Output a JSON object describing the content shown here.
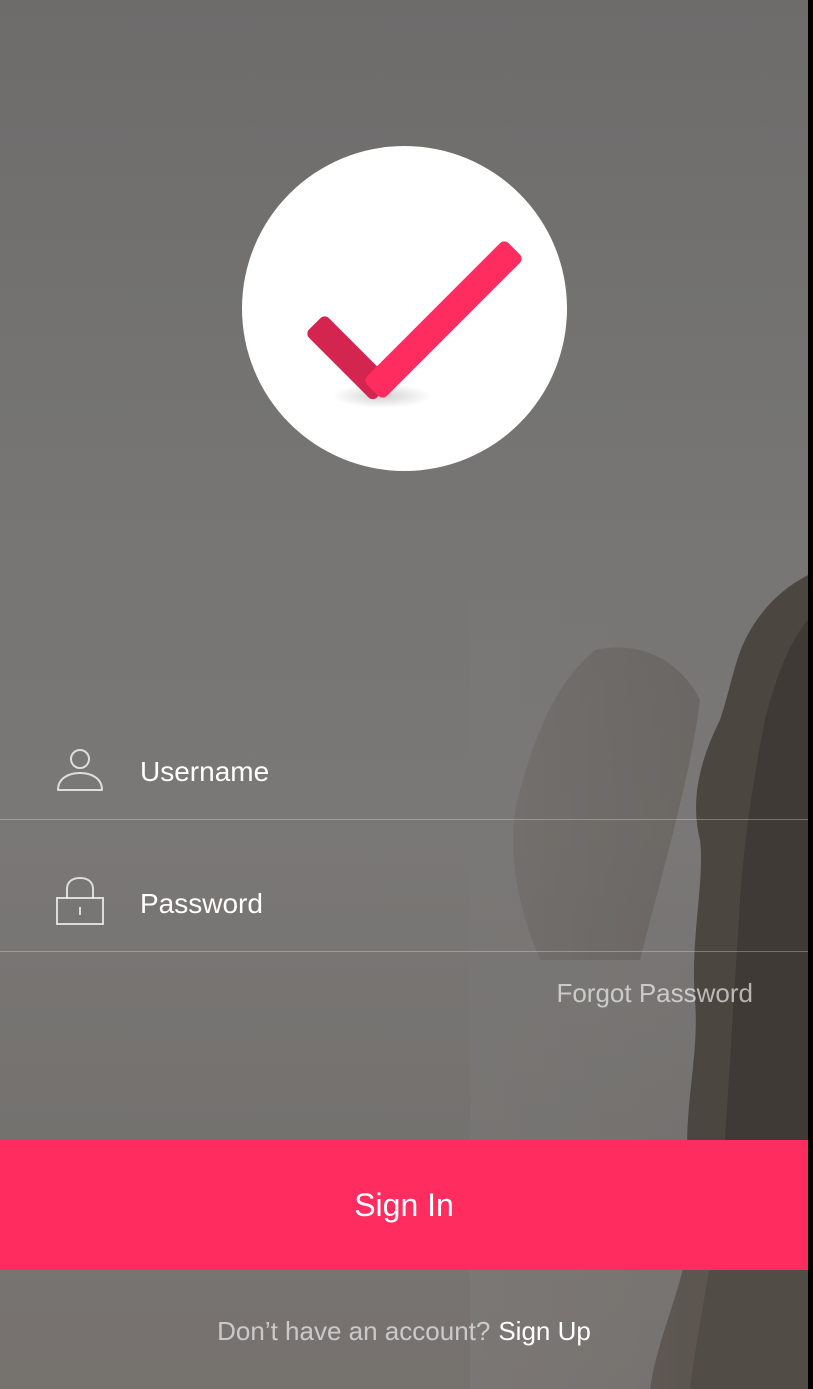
{
  "logo": {
    "icon": "checkmark-icon",
    "circle_color": "#ffffff",
    "check_color": "#ff2d5f"
  },
  "form": {
    "username": {
      "icon": "user-icon",
      "placeholder": "Username",
      "value": ""
    },
    "password": {
      "icon": "lock-icon",
      "placeholder": "Password",
      "value": ""
    },
    "forgot_password_label": "Forgot Password"
  },
  "sign_in": {
    "label": "Sign In",
    "color": "#ff2d5f"
  },
  "sign_up": {
    "prompt": "Don’t have an account?",
    "link_label": "Sign Up"
  }
}
